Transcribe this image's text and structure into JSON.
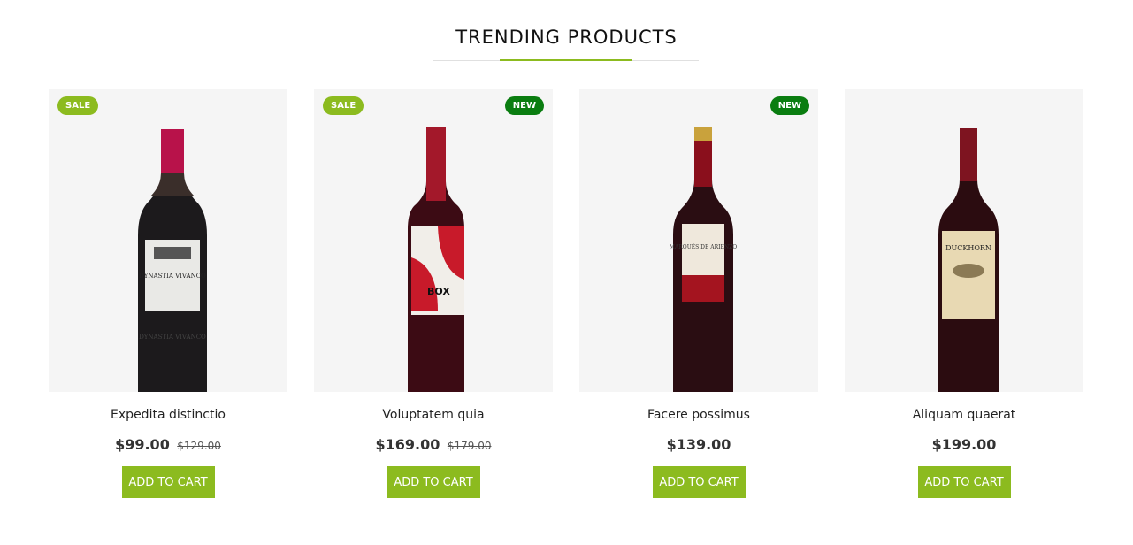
{
  "section": {
    "title": "TRENDING PRODUCTS"
  },
  "colors": {
    "accent": "#8cbb1f",
    "new_badge": "#0a7d10",
    "thumb_bg": "#f5f5f5"
  },
  "products": [
    {
      "name": "Expedita distinctio",
      "price": "$99.00",
      "old_price": "$129.00",
      "badges": {
        "sale": "SALE",
        "new": ""
      },
      "cart_label": "ADD TO CART",
      "label_text": "DYNASTIA VIVANCO",
      "image": "red-wine-bottle-white-label"
    },
    {
      "name": "Voluptatem quia",
      "price": "$169.00",
      "old_price": "$179.00",
      "badges": {
        "sale": "SALE",
        "new": "NEW"
      },
      "cart_label": "ADD TO CART",
      "label_text": "",
      "image": "red-wine-bottle-red-white-label"
    },
    {
      "name": "Facere possimus",
      "price": "$139.00",
      "old_price": "",
      "badges": {
        "sale": "",
        "new": "NEW"
      },
      "cart_label": "ADD TO CART",
      "label_text": "MARQUÉS DE ARIENZO",
      "image": "red-wine-bottle-gold-cap"
    },
    {
      "name": "Aliquam quaerat",
      "price": "$199.00",
      "old_price": "",
      "badges": {
        "sale": "",
        "new": ""
      },
      "cart_label": "ADD TO CART",
      "label_text": "DUCKHORN",
      "image": "red-wine-bottle-cream-label"
    }
  ]
}
